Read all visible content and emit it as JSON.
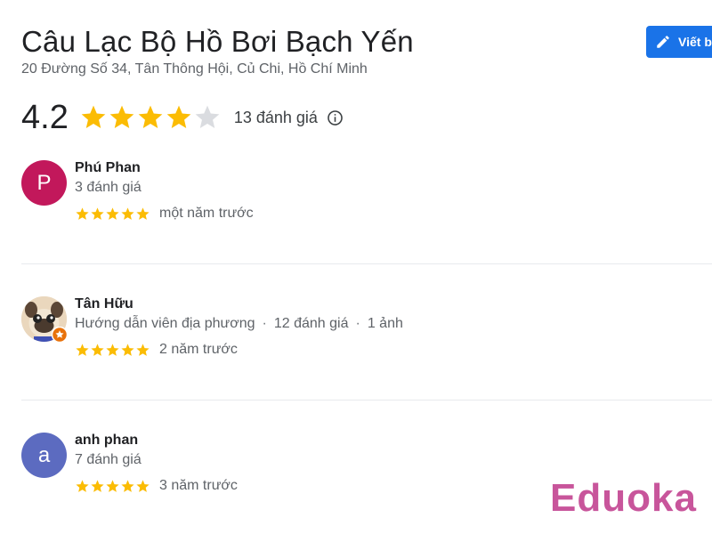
{
  "place": {
    "name": "Câu Lạc Bộ Hồ Bơi Bạch Yến",
    "address": "20 Đường Số 34, Tân Thông Hội, Củ Chi, Hồ Chí Minh"
  },
  "write_review_button": {
    "label": "Viết b",
    "icon": "pencil-icon"
  },
  "summary": {
    "rating": "4.2",
    "stars_filled": 4,
    "stars_total": 5,
    "review_count": "13 đánh giá",
    "info_icon": "info-icon"
  },
  "reviews": [
    {
      "name": "Phú Phan",
      "avatar_letter": "P",
      "avatar_color": "#c2185b",
      "meta": "3 đánh giá",
      "stars": 5,
      "time": "một năm trước"
    },
    {
      "name": "Tân Hữu",
      "avatar_letter": "",
      "avatar_color": "#e8d3b8",
      "meta_guide": "Hướng dẫn viên địa phương",
      "meta_reviews": "12 đánh giá",
      "meta_photos": "1 ảnh",
      "stars": 5,
      "time": "2 năm trước"
    },
    {
      "name": "anh phan",
      "avatar_letter": "a",
      "avatar_color": "#5c6bc0",
      "meta": "7 đánh giá",
      "stars": 5,
      "time": "3 năm trước"
    }
  ],
  "watermark": {
    "text": "Eduoka",
    "color": "#c8559b"
  },
  "colors": {
    "star": "#fbbc04",
    "star_empty": "#dadce0",
    "primary": "#1a73e8"
  }
}
